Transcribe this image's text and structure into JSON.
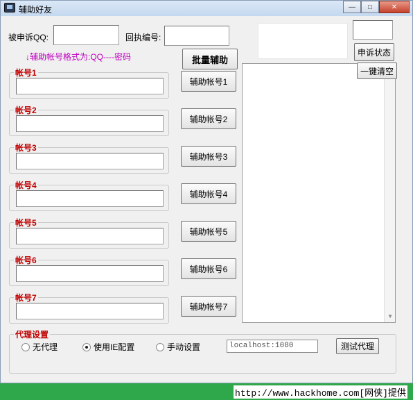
{
  "window": {
    "title": "辅助好友",
    "minimize_glyph": "—",
    "restore_glyph": "□",
    "close_glyph": "✕"
  },
  "top": {
    "complained_qq_label": "被申诉QQ:",
    "complained_qq_value": "",
    "receipt_no_label": "回执编号:",
    "receipt_no_value": "",
    "top_right_value": ""
  },
  "hint": "↓辅助帐号格式为:QQ----密码",
  "buttons": {
    "batch_assist": "批量辅助",
    "appeal_status": "申诉状态",
    "clear_all": "一键清空",
    "test_proxy": "测试代理"
  },
  "accounts": [
    {
      "label": "帐号1",
      "value": "",
      "button": "辅助帐号1"
    },
    {
      "label": "帐号2",
      "value": "",
      "button": "辅助帐号2"
    },
    {
      "label": "帐号3",
      "value": "",
      "button": "辅助帐号3"
    },
    {
      "label": "帐号4",
      "value": "",
      "button": "辅助帐号4"
    },
    {
      "label": "帐号5",
      "value": "",
      "button": "辅助帐号5"
    },
    {
      "label": "帐号6",
      "value": "",
      "button": "辅助帐号6"
    },
    {
      "label": "帐号7",
      "value": "",
      "button": "辅助帐号7"
    }
  ],
  "proxy": {
    "group_title": "代理设置",
    "options": [
      {
        "label": "无代理",
        "selected": false
      },
      {
        "label": "使用IE配置",
        "selected": true
      },
      {
        "label": "手动设置",
        "selected": false
      }
    ],
    "address": "localhost:1080"
  },
  "status_bar": "http://www.hackhome.com[网侠]提供",
  "colors": {
    "accent_red": "#c00000",
    "hint_magenta": "#c000c0",
    "status_green": "#2ea84a"
  }
}
